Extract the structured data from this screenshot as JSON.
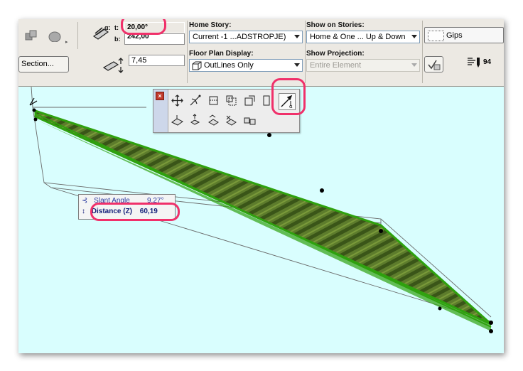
{
  "toolbar": {
    "angle": {
      "top_prefix": "t:",
      "top_value": "20,00°",
      "bottom_prefix": "b:",
      "bottom_value": "242,00"
    },
    "height_value": "7,45",
    "section_button": "Section...",
    "home_story": {
      "label": "Home Story:",
      "value": "Current -1 ...ADSTROPJE)"
    },
    "floor_plan_display": {
      "label": "Floor Plan Display:",
      "value": "OutLines Only"
    },
    "show_on_stories": {
      "label": "Show on Stories:",
      "value": "Home & One ... Up & Down"
    },
    "show_projection": {
      "label": "Show Projection:",
      "value": "Entire Element"
    },
    "material": "Gips",
    "pen_number": "94"
  },
  "tooltip": {
    "slant_label": "Slant Angle",
    "slant_value": "9,27°",
    "distance_label": "Distance (Z)",
    "distance_value": "60,19"
  },
  "palette": {
    "close_glyph": "×",
    "icons": [
      "move-icon",
      "drag-vertex-icon",
      "offset-icon",
      "offset-all-icon",
      "rotate-icon",
      "adjust-icon",
      "slant-angle-icon",
      "elevate-icon",
      "stretch-height-icon",
      "drag-copy-icon",
      "multiply-icon",
      "mirror-icon"
    ]
  },
  "colors": {
    "canvas": "#d9fefe",
    "highlight": "#f0306a",
    "slab_green": "#2fa10e",
    "slab_texture_dark": "#3b5f1a"
  }
}
